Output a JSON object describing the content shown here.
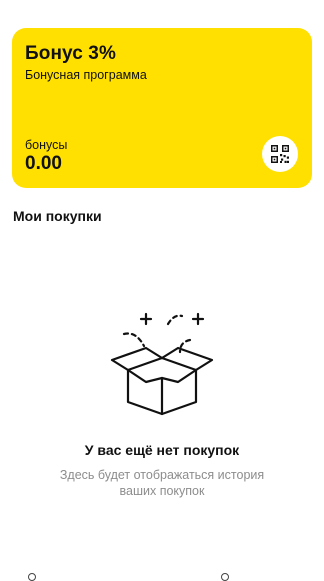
{
  "colors": {
    "card_background": "#ffe000",
    "text_primary": "#111111",
    "text_secondary": "#8d8d8d"
  },
  "bonus_card": {
    "title": "Бонус 3%",
    "subtitle": "Бонусная программа",
    "points_label": "бонусы",
    "points_value": "0.00",
    "qr_icon": "qr-code-icon"
  },
  "purchases": {
    "section_title": "Мои покупки",
    "empty_icon": "open-box-icon",
    "empty_title": "У вас ещё нет покупок",
    "empty_description": "Здесь будет отображаться история ваших покупок"
  }
}
